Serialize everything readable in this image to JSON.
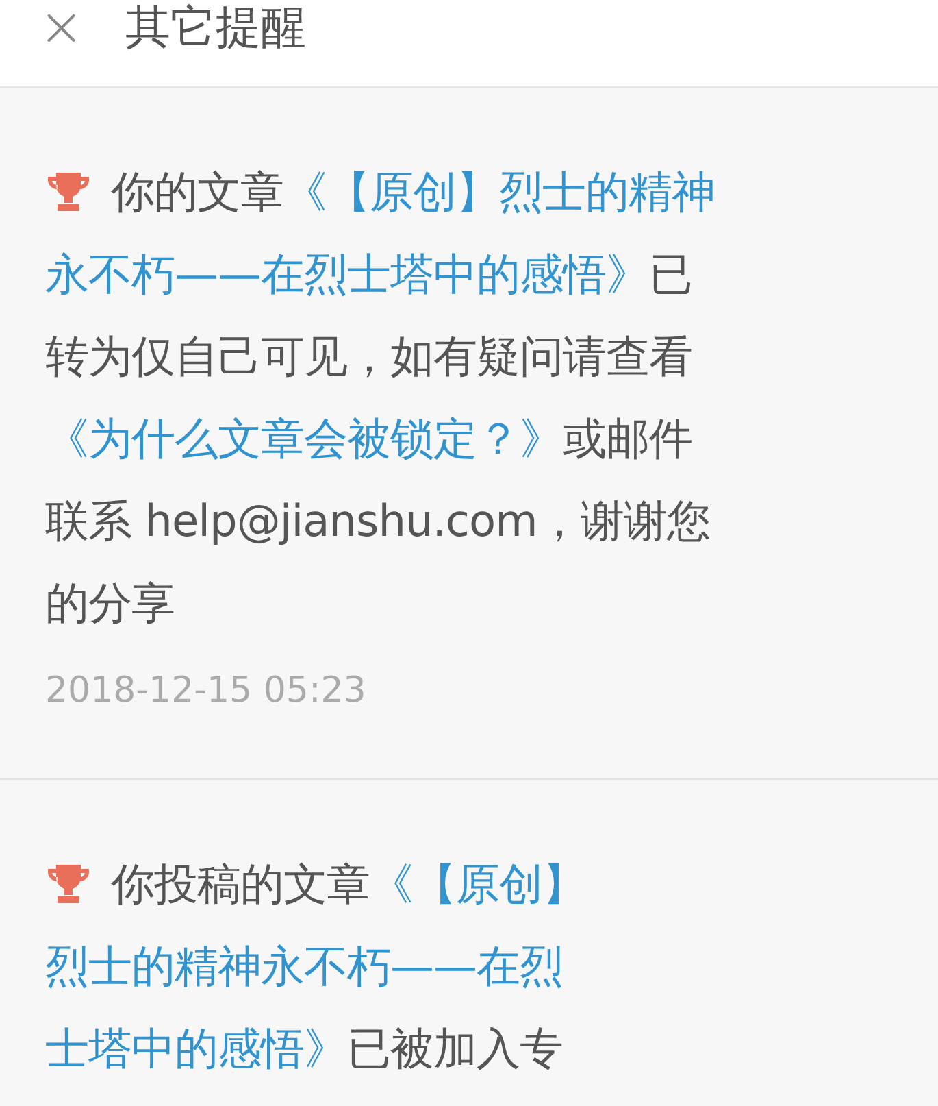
{
  "header": {
    "close": "×",
    "title": "其它提醒"
  },
  "notifications": [
    {
      "lines": [
        [
          {
            "kind": "text",
            "text": "你的文章"
          },
          {
            "kind": "link",
            "text": "《【原创】烈士的精神"
          }
        ],
        [
          {
            "kind": "link",
            "text": "永不朽——在烈士塔中的感悟》"
          },
          {
            "kind": "text",
            "text": "已"
          }
        ],
        [
          {
            "kind": "text",
            "text": "转为仅自己可见，如有疑问请查看"
          }
        ],
        [
          {
            "kind": "link",
            "text": "《为什么文章会被锁定？》"
          },
          {
            "kind": "text",
            "text": "或邮件"
          }
        ],
        [
          {
            "kind": "text",
            "text": "联系 help@jianshu.com，谢谢您"
          }
        ],
        [
          {
            "kind": "text",
            "text": "的分享"
          }
        ]
      ],
      "time": "2018-12-15 05:23"
    },
    {
      "lines": [
        [
          {
            "kind": "text",
            "text": "你投稿的文章"
          },
          {
            "kind": "link",
            "text": "《【原创】"
          }
        ],
        [
          {
            "kind": "link",
            "text": "烈士的精神永不朽——在烈"
          }
        ],
        [
          {
            "kind": "link",
            "text": "士塔中的感悟》"
          },
          {
            "kind": "text",
            "text": "已被加入专"
          }
        ]
      ]
    }
  ]
}
